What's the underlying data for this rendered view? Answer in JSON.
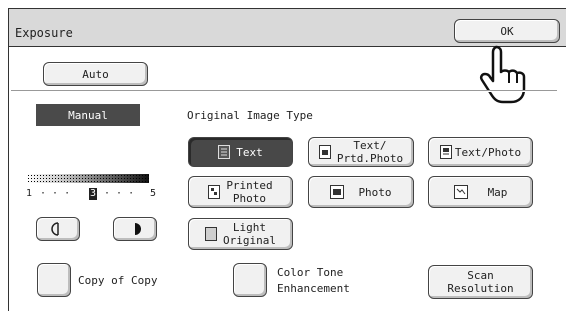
{
  "window": {
    "title": "Exposure"
  },
  "header": {
    "ok_label": "OK"
  },
  "mode": {
    "auto_label": "Auto",
    "manual_label": "Manual"
  },
  "image_type": {
    "section_label": "Original Image Type",
    "options": [
      {
        "label": "Text",
        "selected": true
      },
      {
        "label": "Text/\nPrtd.Photo",
        "selected": false
      },
      {
        "label": "Text/Photo",
        "selected": false
      },
      {
        "label": "Printed\nPhoto",
        "selected": false
      },
      {
        "label": "Photo",
        "selected": false
      },
      {
        "label": "Map",
        "selected": false
      },
      {
        "label": "Light\nOriginal",
        "selected": false
      }
    ]
  },
  "density": {
    "scale_min": "1",
    "scale_max": "5",
    "current_level": 3,
    "scale_dots": "· · ·"
  },
  "bottom": {
    "copy_of_copy_label": "Copy of Copy",
    "color_tone_label_1": "Color Tone",
    "color_tone_label_2": "Enhancement",
    "scan_resolution_label_1": "Scan",
    "scan_resolution_label_2": "Resolution"
  },
  "colors": {
    "selected": "#484848",
    "titlebar": "#d9d9d9",
    "button": "#f1f1f1"
  }
}
